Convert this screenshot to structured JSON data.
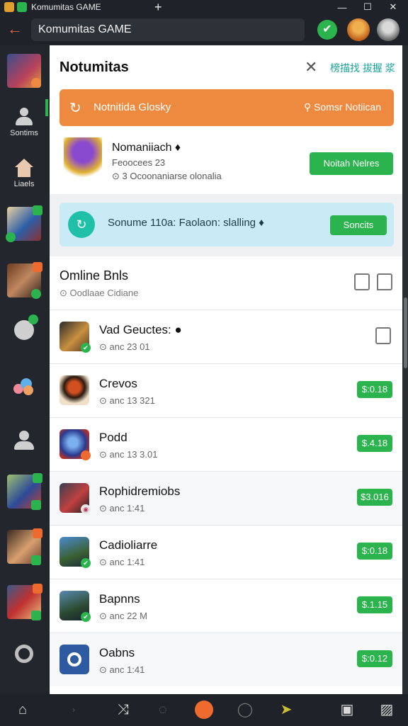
{
  "window": {
    "tab_title": "Komumitas GAME",
    "new_tab": "+",
    "minimize": "—",
    "maximize": "☐",
    "close": "✕"
  },
  "toolbar": {
    "back": "←",
    "address": "Komumitas GAME",
    "check": "✔"
  },
  "sidebar": {
    "items": [
      {
        "label": "Sontims"
      },
      {
        "label": "Liaels"
      }
    ]
  },
  "header": {
    "title": "Notumitas",
    "close": "✕",
    "link": "榜描找 拔握 浆"
  },
  "banner": {
    "icon": "↻",
    "text": "Notnitida Glosky",
    "right": "⚲ Somsr Notiican"
  },
  "featured": {
    "name": "Nomaniiach ♦",
    "sub1": "Feoocees 23",
    "sub2": "⊙ 3 Ocoonaniarse olonalia",
    "button": "Noitah Nelres"
  },
  "promo": {
    "icon": "↻",
    "text": "Sonume 110a: Faolaon: slalling ♦",
    "button": "Soncits"
  },
  "section": {
    "title": "Omline Bnls",
    "subtitle": "⊙ Oodlaae Cidiane"
  },
  "list": [
    {
      "name": "Vad Geuctes: ●",
      "meta": "⊙ anc 23 01",
      "action": "doc"
    },
    {
      "name": "Crevos",
      "meta": "⊙ anc 13 321",
      "price": "$:0.18"
    },
    {
      "name": "Podd",
      "meta": "⊙ anc 13 3.01",
      "price": "$.4.18"
    },
    {
      "name": "Rophidremiobs",
      "meta": "⊙ anc 1:41",
      "price": "$3.016"
    },
    {
      "name": "Cadioliarre",
      "meta": "⊙ anc 1:41",
      "price": "$:0.18"
    },
    {
      "name": "Bapnns",
      "meta": "⊙ anc 22 M",
      "price": "$.1.15"
    },
    {
      "name": "Oabns",
      "meta": "⊙ anc 1:41",
      "price": "$:0.12"
    }
  ],
  "colors": {
    "accent_green": "#2bb34e",
    "banner_orange": "#ee8a3f",
    "promo_blue": "#c9ebf6",
    "teal": "#17a39a"
  }
}
